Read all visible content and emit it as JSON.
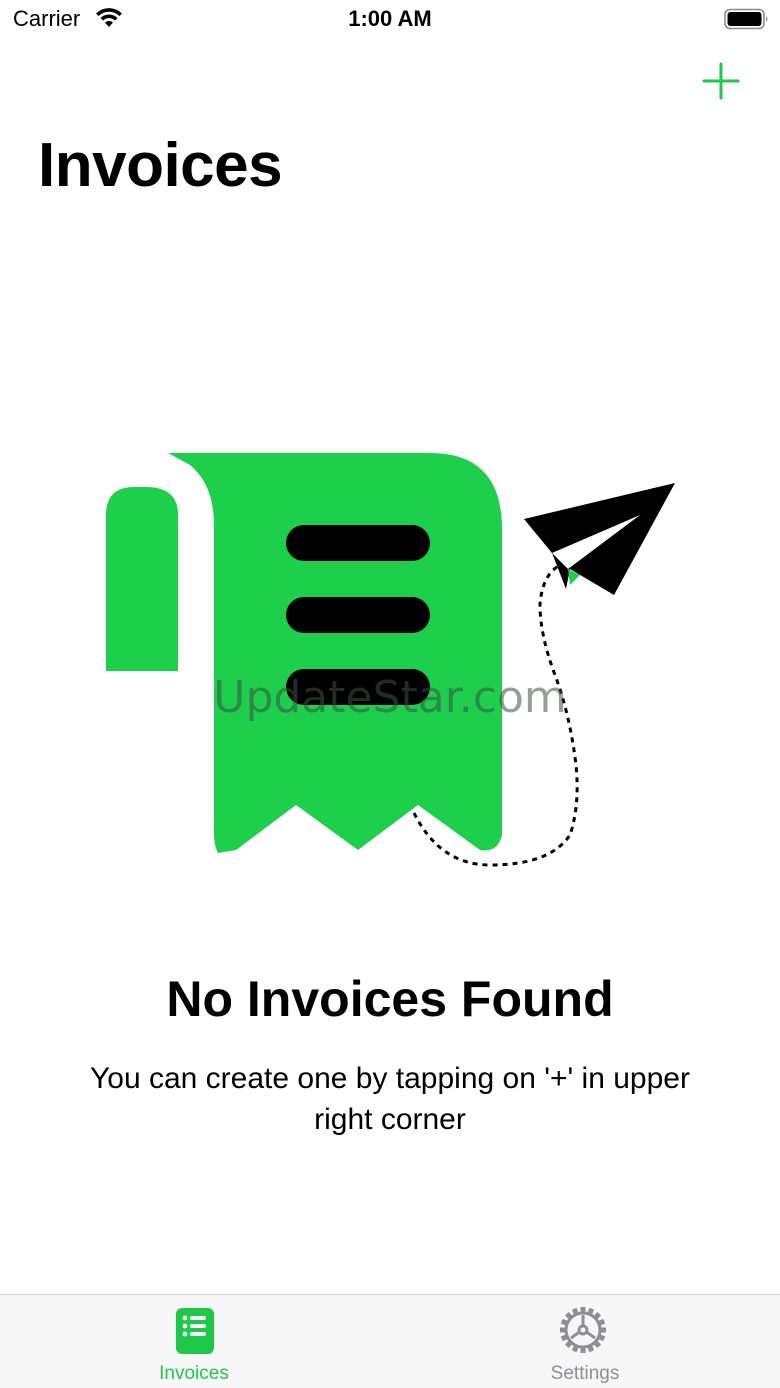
{
  "status_bar": {
    "carrier": "Carrier",
    "time": "1:00 AM",
    "wifi_icon": "wifi-icon",
    "battery_icon": "battery-icon"
  },
  "nav": {
    "title": "Invoices",
    "add_icon": "plus-icon"
  },
  "empty_state": {
    "illustration": "invoice-receipt-paper-plane-illustration",
    "title": "No Invoices Found",
    "message": "You can create one by tapping on '+' in upper right corner"
  },
  "watermark": "UpdateStar.com",
  "tab_bar": {
    "tabs": [
      {
        "label": "Invoices",
        "icon": "invoice-list-icon",
        "selected": true
      },
      {
        "label": "Settings",
        "icon": "gear-icon",
        "selected": false
      }
    ]
  },
  "colors": {
    "accent": "#1ec94a",
    "inactive": "#8e8e93",
    "tab_bar_bg": "#f7f7f7",
    "text": "#000000"
  }
}
